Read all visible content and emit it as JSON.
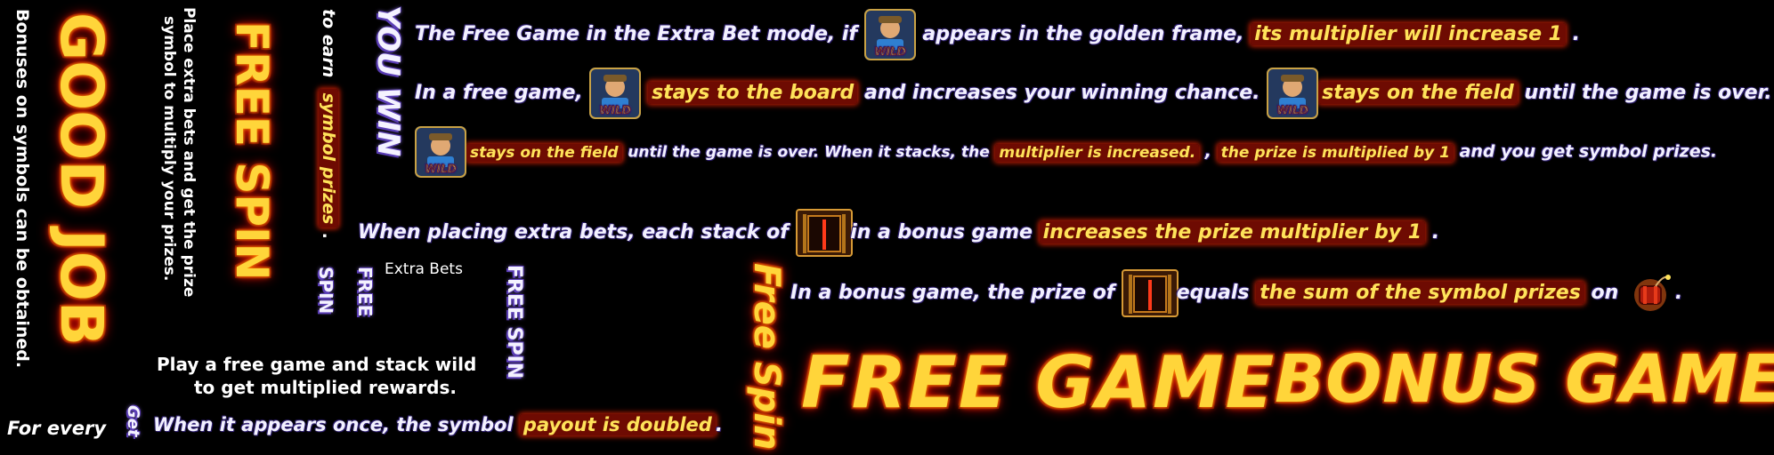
{
  "vertical_texts": {
    "good_job": "GOOD JOB",
    "bonuses_note": "Bonuses on symbols can be obtained.",
    "bonuses_highlight": "obtained",
    "place_bets": "Place extra bets and get the prize",
    "place_bets_2": "symbol to multiply your prizes.",
    "free_spin_big": "FREE SPIN",
    "to_earn": "to earn",
    "symbol_prizes": "symbol prizes",
    "spin": "SPIN",
    "you_win": "YOU WIN",
    "free_small": "FREE",
    "free_spin_outline": "FREE SPIN",
    "free_spin_script": "Free Spin",
    "get": "Get"
  },
  "labels": {
    "extra_bets": "Extra Bets",
    "play_free_1": "Play a free game and stack wild",
    "play_free_2": "to get multiplied rewards.",
    "for_every": "For every",
    "appears_once": "When it appears once, the symbol",
    "payout_doubled": "payout is doubled",
    "period": "."
  },
  "rows": {
    "r1_a": "The Free Game in the Extra Bet mode, if",
    "r1_b": "appears in the golden frame,",
    "r1_hl": "its multiplier will increase 1",
    "r1_end": ".",
    "r2_a": "In a free game,",
    "r2_hl": "stays to the board",
    "r2_b": "and increases your winning chance.",
    "r2_hl2": "stays on the field",
    "r2_c": "until the game is over.",
    "r3_hl": "stays on the field",
    "r3_a": "until the game is over. When it stacks, the",
    "r3_hl2": "multiplier is increased.",
    "r3_comma": ",",
    "r3_hl3": "the prize is multiplied by 1",
    "r3_b": "and you get symbol prizes.",
    "r4_a": "When placing extra bets, each stack of",
    "r4_b": "in a bonus game",
    "r4_hl": "increases the prize multiplier by 1",
    "r4_end": ".",
    "r5_a": "In a bonus game, the prize of",
    "r5_b": "equals",
    "r5_hl": "the sum of the symbol prizes",
    "r5_c": "on",
    "r5_end": "."
  },
  "titles": {
    "free_game": "FREE GAME",
    "bonus_game": "BONUS GAME"
  },
  "icons": {
    "wild": "wild-miner-icon",
    "gate": "golden-gate-icon",
    "bomb": "dynamite-bomb-icon"
  },
  "colors": {
    "highlight_text": "#ffe35a",
    "highlight_bg": "#6e0b02",
    "fire_gold": "#ffd53a",
    "fire_red": "#e00000",
    "body_text": "#f3f1ff",
    "purple_shadow": "#5a3db5"
  }
}
